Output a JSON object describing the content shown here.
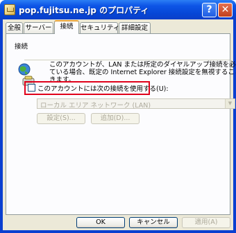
{
  "window": {
    "title": "pop.fujitsu.ne.jp のプロパティ",
    "help_glyph": "?",
    "close_glyph": "✕"
  },
  "tabs": [
    {
      "label": "全般"
    },
    {
      "label": "サーバー"
    },
    {
      "label": "接続",
      "active": true
    },
    {
      "label": "セキュリティ"
    },
    {
      "label": "詳細設定"
    }
  ],
  "connection": {
    "group_label": "接続",
    "description_lines": [
      "このアカウントが、LAN または所定のダイヤルアップ接続を必要とし",
      "ている場合、既定の Internet Explorer 接続設定を無視することがで",
      "きます。"
    ],
    "checkbox": {
      "label": "このアカウントには次の接続を使用する(U):",
      "checked": false
    },
    "select": {
      "value": "ローカル エリア ネットワーク (LAN)",
      "disabled": true
    },
    "settings_label": "設定(S)...",
    "add_label": "追加(D)..."
  },
  "footer": {
    "ok_label": "OK",
    "cancel_label": "キャンセル",
    "apply_label": "適用(A)"
  },
  "colors": {
    "title_bar": "#0a4fe0",
    "dialog_bg": "#ece9d8",
    "highlight_border": "#e0001a"
  }
}
